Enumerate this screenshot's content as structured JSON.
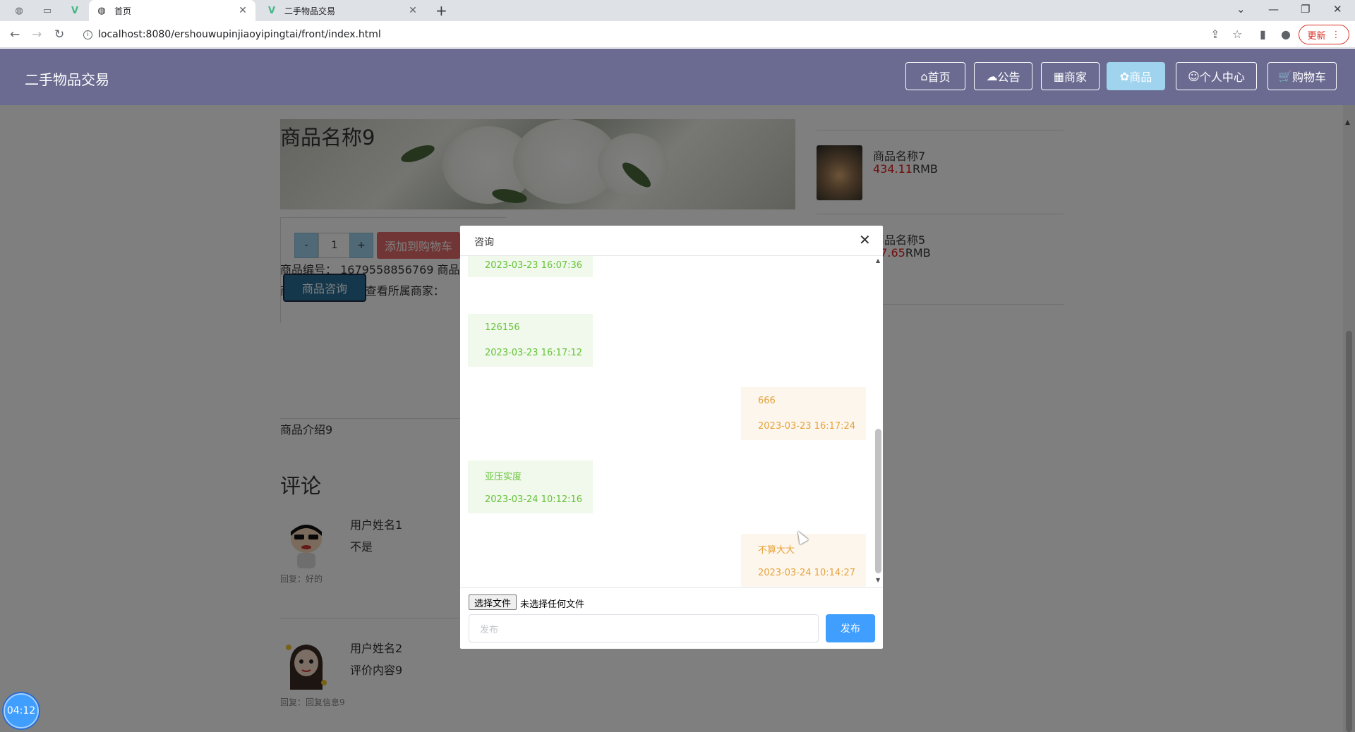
{
  "browser": {
    "tabs": [
      {
        "title": "首页",
        "active": true
      },
      {
        "title": "二手物品交易",
        "active": false
      }
    ],
    "url": "localhost:8080/ershouwupinjiaoyipingtai/front/index.html",
    "update_label": "更新"
  },
  "site": {
    "title": "二手物品交易",
    "nav": [
      {
        "label": "首页",
        "icon": "home-icon",
        "active": false
      },
      {
        "label": "公告",
        "icon": "cloud-icon",
        "active": false
      },
      {
        "label": "商家",
        "icon": "grid-icon",
        "active": false
      },
      {
        "label": "商品",
        "icon": "goods-icon",
        "active": true
      },
      {
        "label": "个人中心",
        "icon": "user-icon",
        "active": false
      },
      {
        "label": "购物车",
        "icon": "cart-icon",
        "active": false
      }
    ]
  },
  "product": {
    "name": "商品名称9",
    "code_line": "商品编号：  1679558856769    商品",
    "heat_line": "商品热度：  264    查看所属商家：",
    "qty": "1",
    "minus": "-",
    "plus": "+",
    "add_to_cart": "添加到购物车",
    "consult": "商品咨询",
    "intro": "商品介绍9"
  },
  "comments": {
    "title": "评论",
    "items": [
      {
        "user": "用户姓名1",
        "text": "不是",
        "reply": "回复：好的"
      },
      {
        "user": "用户姓名2",
        "text": "评价内容9",
        "reply": "回复：回复信息9"
      }
    ]
  },
  "sidebar": {
    "items": [
      {
        "name": "商品名称7",
        "price": "434.11",
        "unit": "RMB"
      },
      {
        "name": "商品名称5",
        "price": "57.65",
        "unit": "RMB"
      }
    ]
  },
  "dialog": {
    "title": "咨询",
    "messages": [
      {
        "side": "left",
        "text": "",
        "time": "2023-03-23 16:07:36"
      },
      {
        "side": "left",
        "text": "126156",
        "time": "2023-03-23 16:17:12"
      },
      {
        "side": "right",
        "text": "666",
        "time": "2023-03-23 16:17:24"
      },
      {
        "side": "left",
        "text": "亚压实度",
        "time": "2023-03-24 10:12:16"
      },
      {
        "side": "right",
        "text": "不算大大",
        "time": "2023-03-24 10:14:27"
      }
    ],
    "file_button": "选择文件",
    "file_status": "未选择任何文件",
    "input_placeholder": "发布",
    "send_label": "发布"
  },
  "timer": "04:12",
  "colors": {
    "header_bg": "#6b6b92",
    "nav_active": "#9fd3ee",
    "price_red": "#e31b1b",
    "msg_left_bg": "#f0f9eb",
    "msg_left_text": "#67c23a",
    "msg_right_bg": "#fdf6ec",
    "msg_right_text": "#e6a23c",
    "send_btn": "#409eff",
    "add_cart": "#e36a6a",
    "consult_btn": "#2a6f97"
  }
}
